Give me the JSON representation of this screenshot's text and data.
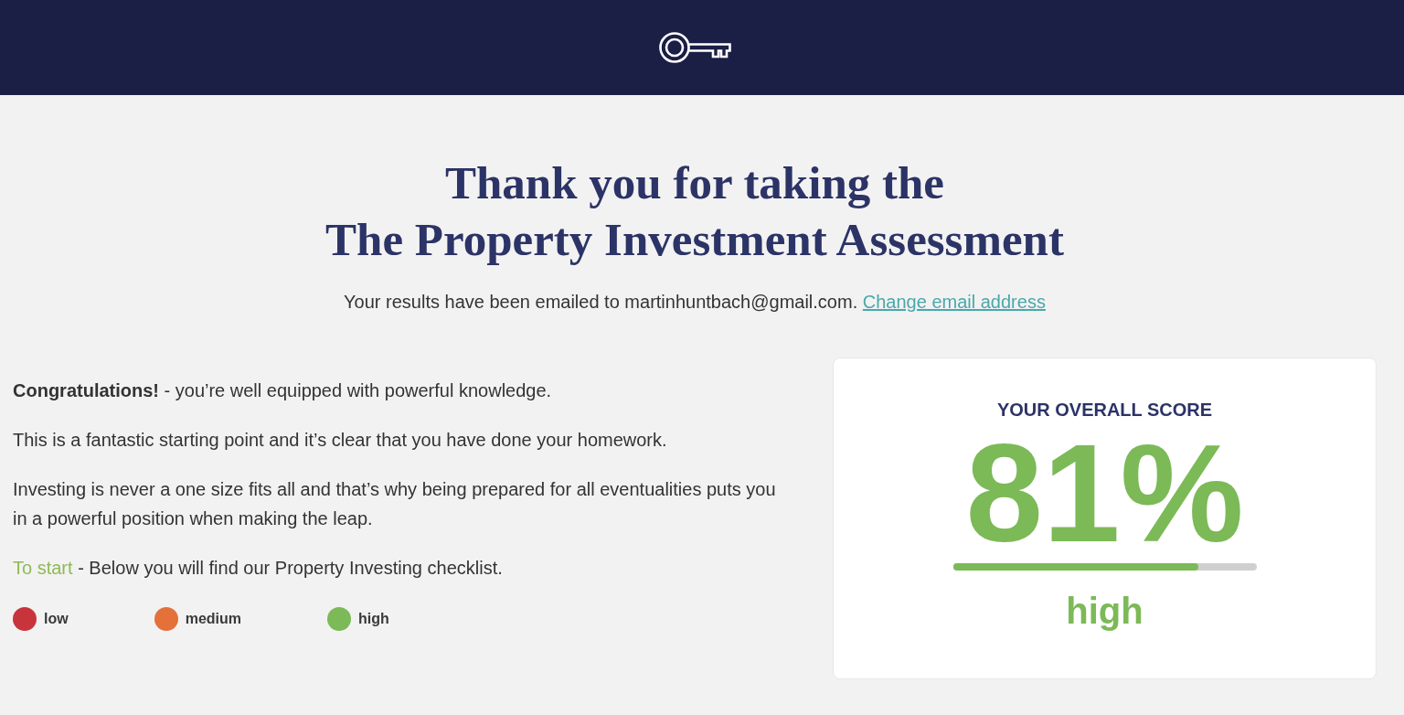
{
  "heading": {
    "lines": [
      "Thank you for taking the",
      "The Property Investment Assessment"
    ]
  },
  "notice": {
    "text": "Your results have been emailed to martinhuntbach@gmail.com.",
    "link": "Change email address"
  },
  "message": {
    "paragraphs": [
      {
        "text": "**Congratulations!** - you’re well equipped with powerful knowledge."
      },
      {
        "text": "This is a fantastic starting point and it’s clear that you have done your homework."
      },
      {
        "text": "Investing is never a one size fits all and that’s why being prepared for all eventualities puts you in a powerful position when making the leap."
      },
      {
        "accent": "To start",
        "text": "- Below you will find our Property Investing checklist."
      }
    ]
  },
  "legend": [
    {
      "label": "low",
      "color": "#c8343c"
    },
    {
      "label": "medium",
      "color": "#e4703a"
    },
    {
      "label": "high",
      "color": "#7cb957"
    }
  ],
  "score": {
    "title": "YOUR OVERALL SCORE",
    "value": "81%",
    "level": 0.81,
    "rating": "high"
  }
}
